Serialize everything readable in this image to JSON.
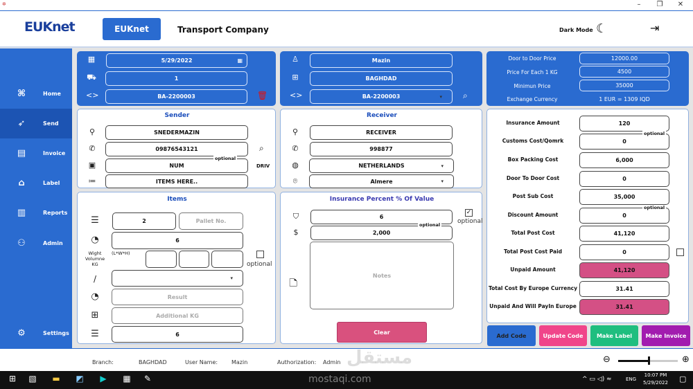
{
  "window": {
    "minimize": "–",
    "maximize": "❐",
    "close": "✕"
  },
  "header": {
    "logo": "EUKnet",
    "brand_button": "EUKnet",
    "company": "Transport Company",
    "dark_mode": "Dark Mode"
  },
  "sidebar": {
    "items": [
      {
        "label": "Home",
        "icon": "home-grid-icon"
      },
      {
        "label": "Send",
        "icon": "send-icon"
      },
      {
        "label": "Invoice",
        "icon": "invoice-icon"
      },
      {
        "label": "Label",
        "icon": "tag-icon"
      },
      {
        "label": "Reports",
        "icon": "chart-icon"
      },
      {
        "label": "Admin",
        "icon": "admin-icon"
      }
    ],
    "settings": "Settings"
  },
  "shipment": {
    "date": "5/29/2022",
    "vehicle": "1",
    "code": "BA-2200003"
  },
  "user": {
    "name": "Mazin",
    "branch": "BAGHDAD",
    "code_select": "BA-2200003"
  },
  "pricing": {
    "door_to_door_label": "Door to Door Price",
    "door_to_door": "12000.00",
    "per_kg_label": "Price For Each 1 KG",
    "per_kg": "4500",
    "min_label": "Minimun Price",
    "min": "35000",
    "exchange_label": "Exchange Currency",
    "exchange": "1 EUR = 1309 IQD"
  },
  "sender": {
    "title": "Sender",
    "name": "SNEDERMAZIN",
    "phone": "09876543121",
    "num": "NUM",
    "num_optional": "optional",
    "items": "ITEMS HERE..",
    "driv": "DRIV"
  },
  "receiver": {
    "title": "Receiver",
    "name": "RECEIVER",
    "phone": "998877",
    "country": "NETHERLANDS",
    "city": "Almere"
  },
  "items": {
    "title": "Items",
    "count": "2",
    "pallet_placeholder": "Pallet No.",
    "weight": "6",
    "weight_label": "Wight Volumne KG",
    "dims_label": "(L*W*H)",
    "optional": "optional",
    "divider_symbol": "/",
    "result_placeholder": "Result",
    "additional_placeholder": "Additional KG",
    "total": "6"
  },
  "insurance": {
    "title": "Insurance Percent % Of Value",
    "percent": "6",
    "value": "2,000",
    "value_optional": "optional",
    "optional": "optional",
    "notes_placeholder": "Notes",
    "clear": "Clear"
  },
  "costs": {
    "optional": "optional",
    "rows": [
      {
        "label": "Insurance Amount",
        "value": "120"
      },
      {
        "label": "Customs Cost/Qomrk",
        "value": "0"
      },
      {
        "label": "Box Packing Cost",
        "value": "6,000"
      },
      {
        "label": "Door To Door Cost",
        "value": "0"
      },
      {
        "label": "Post Sub Cost",
        "value": "35,000"
      },
      {
        "label": "Discount Amount",
        "value": "0"
      },
      {
        "label": "Total Post Cost",
        "value": "41,120"
      },
      {
        "label": "Total Post Cost Paid",
        "value": "0"
      },
      {
        "label": "Unpaid Amount",
        "value": "41,120"
      },
      {
        "label": "Total Cost By Europe Currency",
        "value": "31.41"
      },
      {
        "label": "Unpaid And Will PayIn Europe",
        "value": "31.41"
      }
    ]
  },
  "actions": {
    "add": "Add Code",
    "update": "Update Code",
    "label": "Make Label",
    "invoice": "Make Invoice",
    "colors": {
      "add": "#2a6bd0",
      "update": "#f0458a",
      "label": "#1fbe7f",
      "invoice": "#a21caf"
    }
  },
  "status": {
    "branch_label": "Branch:",
    "branch": "BAGHDAD",
    "user_label": "User Name:",
    "user": "Mazin",
    "auth_label": "Authorization:",
    "auth": "Admin",
    "zoom_level": 0.5
  },
  "taskbar": {
    "time": "10:07 PM",
    "date": "5/29/2022",
    "lang": "ENG"
  },
  "watermark": "mostaqi.com"
}
